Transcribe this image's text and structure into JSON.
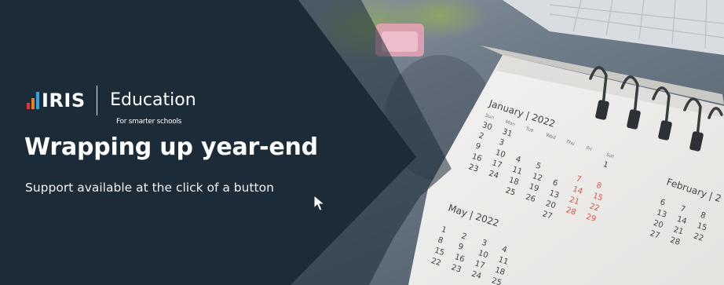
{
  "brand": {
    "name": "IRIS",
    "product": "Education",
    "tagline": "For smarter schools",
    "bar_colors": [
      "#e2313b",
      "#f07d1b",
      "#2fa4e0"
    ]
  },
  "banner": {
    "headline": "Wrapping up year-end",
    "subheadline": "Support available at the click of a button",
    "panel_color": "#1c2b38"
  },
  "calendar": {
    "january_header": "January | 2022",
    "february_header": "February | 2",
    "may_header": "May | 2022",
    "weekdays": [
      "Sun",
      "Mon",
      "Tue",
      "Wed",
      "Thu",
      "Fri",
      "Sat"
    ],
    "january_rows": [
      [
        "30",
        "31",
        "",
        "",
        "",
        "",
        "1"
      ],
      [
        "2",
        "3",
        "",
        "",
        "",
        "",
        ""
      ],
      [
        "9",
        "10",
        "4",
        "5",
        "",
        "7",
        "8"
      ],
      [
        "16",
        "17",
        "11",
        "12",
        "6",
        "14",
        "15"
      ],
      [
        "23",
        "24",
        "18",
        "19",
        "13",
        "21",
        "22"
      ],
      [
        "",
        "",
        "25",
        "26",
        "20",
        "28",
        "29"
      ],
      [
        "",
        "",
        "",
        "",
        "27",
        "",
        ""
      ]
    ],
    "february_numbers": [
      "6",
      "7",
      "8",
      "13",
      "14",
      "15",
      "20",
      "21",
      "22",
      "27",
      "28"
    ],
    "may_rows": [
      [
        "1",
        "2",
        "3",
        "4"
      ],
      [
        "8",
        "9",
        "10",
        "11"
      ],
      [
        "15",
        "16",
        "17",
        "18"
      ],
      [
        "22",
        "23",
        "24",
        "25"
      ]
    ]
  }
}
